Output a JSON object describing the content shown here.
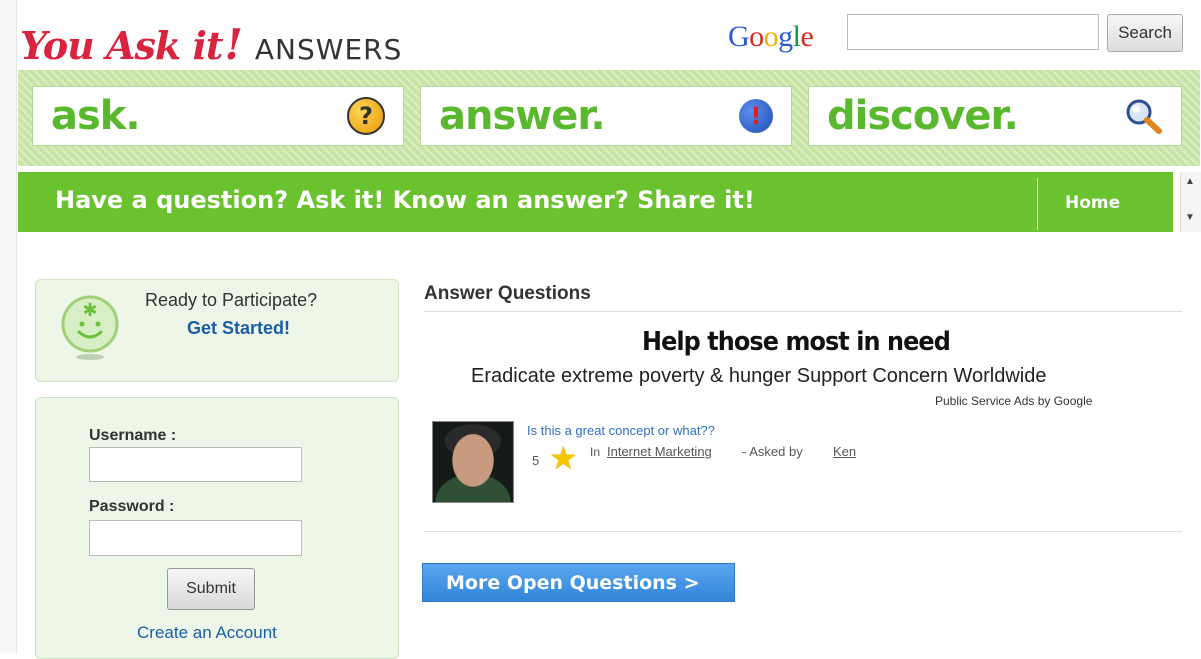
{
  "header": {
    "logo_brand": "You Ask it",
    "logo_bang": "!",
    "logo_sub": "ANSWERS",
    "google_logo": [
      "G",
      "o",
      "o",
      "g",
      "l",
      "e"
    ],
    "search_button": "Search",
    "search_value": ""
  },
  "tabs": [
    {
      "label": "ask.",
      "icon": "question-icon"
    },
    {
      "label": "answer.",
      "icon": "exclamation-icon"
    },
    {
      "label": "discover.",
      "icon": "magnifier-icon"
    }
  ],
  "nav": {
    "slogan": "Have a question? Ask it! Know an answer? Share it!",
    "home": "Home"
  },
  "participate": {
    "question": "Ready to Participate?",
    "link": "Get Started!"
  },
  "login": {
    "username_label": "Username :",
    "password_label": "Password :",
    "submit": "Submit",
    "create_account": "Create an Account"
  },
  "main": {
    "title": "Answer Questions",
    "ad_headline": "Help those most in need",
    "ad_body": "Eradicate extreme poverty & hunger Support Concern Worldwide",
    "ad_credit": "Public Service Ads by Google",
    "question": {
      "title": "Is this a great concept or what??",
      "votes": "5",
      "in_label": "In",
      "category": "Internet Marketing",
      "asked_by": "- Asked by",
      "author": "Ken"
    },
    "more_button": "More Open Questions >"
  },
  "colors": {
    "brand_red": "#d9243f",
    "green": "#6ac22f",
    "link_blue": "#1b5ea8",
    "button_blue": "#3185d8"
  }
}
